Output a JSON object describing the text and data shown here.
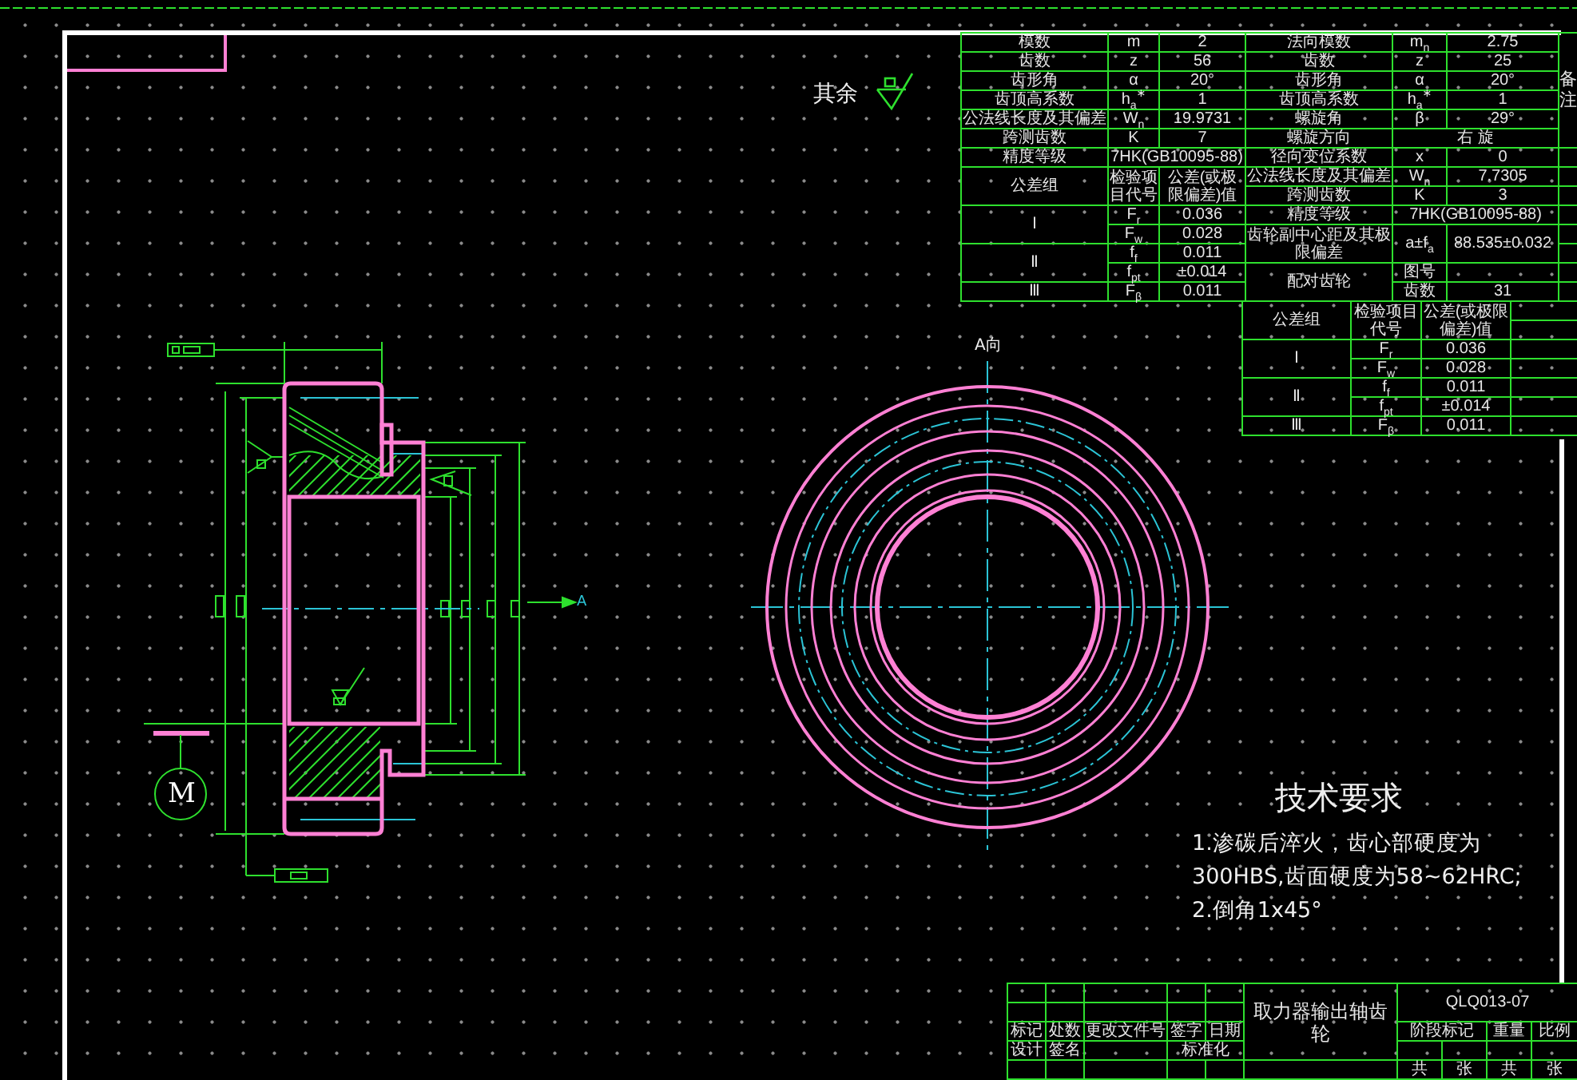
{
  "sheet_note": {
    "label": "其余"
  },
  "gear_parameters_table": {
    "rows": [
      [
        {
          "text": "模数"
        },
        {
          "text": "m"
        },
        {
          "text": "2"
        },
        {
          "text": "法向模数"
        },
        {
          "text": "m$_{n}$"
        },
        {
          "text": "2.75"
        },
        {
          "text": "备注",
          "rowspan": 6,
          "kind": "vertical"
        }
      ],
      [
        {
          "text": "齿数"
        },
        {
          "text": "z"
        },
        {
          "text": "56"
        },
        {
          "text": "齿数"
        },
        {
          "text": "z"
        },
        {
          "text": "25"
        }
      ],
      [
        {
          "text": "齿形角"
        },
        {
          "text": "α"
        },
        {
          "text": "20°"
        },
        {
          "text": "齿形角"
        },
        {
          "text": "α"
        },
        {
          "text": "20°"
        }
      ],
      [
        {
          "text": "齿顶高系数"
        },
        {
          "text": "h$_{a}$$^{∗}$"
        },
        {
          "text": "1"
        },
        {
          "text": "齿顶高系数"
        },
        {
          "text": "h$_{a}$$^{∗}$"
        },
        {
          "text": "1"
        }
      ],
      [
        {
          "text": "公法线长度及其偏差"
        },
        {
          "text": "W$_{n}$"
        },
        {
          "text": "19.9731"
        },
        {
          "text": "螺旋角"
        },
        {
          "text": "β"
        },
        {
          "text": "29°"
        }
      ],
      [
        {
          "text": "跨测齿数"
        },
        {
          "text": "K"
        },
        {
          "text": "7"
        },
        {
          "text": "螺旋方向"
        },
        {
          "text": "右 旋",
          "colspan": 2
        }
      ],
      [
        {
          "text": "精度等级"
        },
        {
          "text": "7HK(GB10095-88)",
          "colspan": 2
        },
        {
          "text": "径向变位系数"
        },
        {
          "text": "x"
        },
        {
          "text": "0"
        },
        {}
      ],
      [
        {
          "text": "公差组",
          "rowspan": 2
        },
        {
          "text": "检验项目代号",
          "rowspan": 2
        },
        {
          "text": "公差(或极限偏差)值",
          "rowspan": 2
        },
        {
          "text": "公法线长度及其偏差"
        },
        {
          "text": "W$_{n}$"
        },
        {
          "text": "7.7305"
        },
        {}
      ],
      [
        {
          "text": "跨测齿数"
        },
        {
          "text": "K"
        },
        {
          "text": "3"
        },
        {}
      ],
      [
        {
          "text": "Ⅰ",
          "rowspan": 2
        },
        {
          "text": "F$_{r}$"
        },
        {
          "text": "0.036"
        },
        {
          "text": "精度等级"
        },
        {
          "text": "7HK(GB10095-88)",
          "colspan": 2
        },
        {}
      ],
      [
        {
          "text": "F$_{w}$"
        },
        {
          "text": "0.028"
        },
        {
          "text": "齿轮副中心距及其极限偏差",
          "rowspan": 2
        },
        {
          "text": "a±f$_{a}$",
          "rowspan": 2
        },
        {
          "text": "88.535±0.032",
          "rowspan": 2
        },
        {}
      ],
      [
        {
          "text": "Ⅱ",
          "rowspan": 2
        },
        {
          "text": "f$_{f}$"
        },
        {
          "text": "0.011"
        },
        {}
      ],
      [
        {
          "text": "f$_{pt}$"
        },
        {
          "text": "±0.014"
        },
        {
          "text": "配对齿轮",
          "rowspan": 2
        },
        {
          "text": "图号"
        },
        {},
        {}
      ],
      [
        {
          "text": "Ⅲ"
        },
        {
          "text": "F$_{β}$"
        },
        {
          "text": "0.011"
        },
        {
          "text": "齿数"
        },
        {
          "text": "31"
        },
        {}
      ]
    ]
  },
  "tolerance_table": {
    "rows": [
      [
        {
          "text": "公差组",
          "rowspan": 2
        },
        {
          "text": "检验项目代号",
          "rowspan": 2
        },
        {
          "text": "公差(或极限偏差)值",
          "rowspan": 2
        },
        {}
      ],
      [
        {}
      ],
      [
        {
          "text": "Ⅰ",
          "rowspan": 2
        },
        {
          "text": "F$_{r}$"
        },
        {
          "text": "0.036"
        },
        {}
      ],
      [
        {
          "text": "F$_{w}$"
        },
        {
          "text": "0.028"
        },
        {}
      ],
      [
        {
          "text": "Ⅱ",
          "rowspan": 2
        },
        {
          "text": "f$_{f}$"
        },
        {
          "text": "0.011"
        },
        {}
      ],
      [
        {
          "text": "f$_{pt}$"
        },
        {
          "text": "±0.014"
        },
        {}
      ],
      [
        {
          "text": "Ⅲ"
        },
        {
          "text": "F$_{β}$"
        },
        {
          "text": "0.011"
        },
        {}
      ]
    ]
  },
  "section_view": {
    "cut_label": "A",
    "motor_label": "M"
  },
  "end_view": {
    "view_label": "A向"
  },
  "technical_requirements": {
    "title": "技术要求",
    "lines": [
      "1.渗碳后淬火，齿心部硬度为",
      "300HBS,齿面硬度为58~62HRC;",
      "2.倒角1x45°"
    ]
  },
  "title_block": {
    "rows": [
      [
        {},
        {},
        {},
        {},
        {},
        {
          "text": "取力器输出轴齿轮",
          "rowspan": 4,
          "kind": "name"
        },
        {
          "text": "QLQ013-07",
          "colspan": 4,
          "rowspan": 2
        }
      ],
      [
        {},
        {},
        {},
        {},
        {}
      ],
      [
        {
          "text": "标记"
        },
        {
          "text": "处数"
        },
        {
          "text": "更改文件号"
        },
        {
          "text": "签字"
        },
        {
          "text": "日期"
        },
        {
          "text": "阶段标记",
          "colspan": 2
        },
        {
          "text": "重量"
        },
        {
          "text": "比例"
        }
      ],
      [
        {
          "text": "设计"
        },
        {
          "text": "签名"
        },
        {},
        {
          "text": "标准化",
          "colspan": 2
        },
        {},
        {},
        {},
        {}
      ],
      [
        {},
        {},
        {},
        {},
        {},
        {},
        {
          "text": "共"
        },
        {
          "text": "张"
        },
        {
          "text": "共"
        },
        {
          "text": "张"
        }
      ]
    ]
  }
}
